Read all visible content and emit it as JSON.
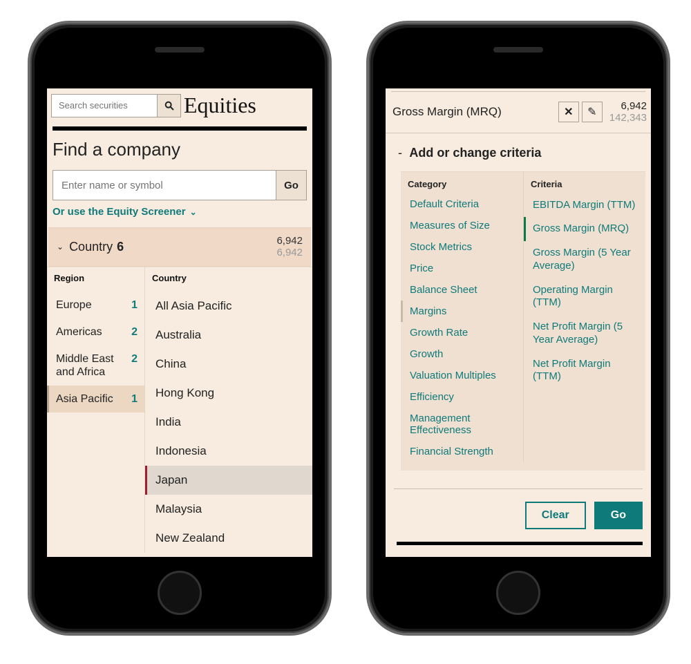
{
  "left": {
    "top_search_placeholder": "Search securities",
    "page_title": "Equities",
    "heading": "Find a company",
    "find_placeholder": "Enter name or symbol",
    "find_go": "Go",
    "screener_link": "Or use the Equity Screener",
    "accordion": {
      "label": "Country",
      "count": "6",
      "num_top": "6,942",
      "num_bottom": "6,942"
    },
    "region_header": "Region",
    "country_header": "Country",
    "regions": [
      {
        "label": "Europe",
        "count": "1",
        "selected": false
      },
      {
        "label": "Americas",
        "count": "2",
        "selected": false
      },
      {
        "label": "Middle East and Africa",
        "count": "2",
        "selected": false
      },
      {
        "label": "Asia Pacific",
        "count": "1",
        "selected": true
      }
    ],
    "countries": [
      {
        "label": "All Asia Pacific",
        "selected": false
      },
      {
        "label": "Australia",
        "selected": false
      },
      {
        "label": "China",
        "selected": false
      },
      {
        "label": "Hong Kong",
        "selected": false
      },
      {
        "label": "India",
        "selected": false
      },
      {
        "label": "Indonesia",
        "selected": false
      },
      {
        "label": "Japan",
        "selected": true
      },
      {
        "label": "Malaysia",
        "selected": false
      },
      {
        "label": "New Zealand",
        "selected": false
      }
    ]
  },
  "right": {
    "criteria_title": "Gross Margin (MRQ)",
    "num_top": "6,942",
    "num_bottom": "142,343",
    "add_change": "Add or change criteria",
    "category_header": "Category",
    "criteria_header": "Criteria",
    "categories": [
      {
        "label": "Default Criteria",
        "selected": false
      },
      {
        "label": "Measures of Size",
        "selected": false
      },
      {
        "label": "Stock Metrics",
        "selected": false
      },
      {
        "label": "Price",
        "selected": false
      },
      {
        "label": "Balance Sheet",
        "selected": false
      },
      {
        "label": "Margins",
        "selected": true
      },
      {
        "label": "Growth Rate",
        "selected": false
      },
      {
        "label": "Growth",
        "selected": false
      },
      {
        "label": "Valuation Multiples",
        "selected": false
      },
      {
        "label": "Efficiency",
        "selected": false
      },
      {
        "label": "Management Effectiveness",
        "selected": false
      },
      {
        "label": "Financial Strength",
        "selected": false
      }
    ],
    "criteria": [
      {
        "label": "EBITDA Margin (TTM)",
        "selected": false
      },
      {
        "label": "Gross Margin (MRQ)",
        "selected": true
      },
      {
        "label": "Gross Margin (5 Year Average)",
        "selected": false
      },
      {
        "label": "Operating Margin (TTM)",
        "selected": false
      },
      {
        "label": "Net Profit Margin (5 Year Average)",
        "selected": false
      },
      {
        "label": "Net Profit Margin (TTM)",
        "selected": false
      }
    ],
    "clear": "Clear",
    "go": "Go"
  }
}
